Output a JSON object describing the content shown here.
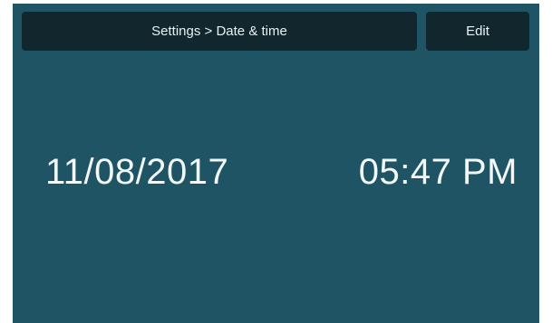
{
  "header": {
    "breadcrumb": "Settings > Date & time",
    "edit_label": "Edit"
  },
  "main": {
    "date": "11/08/2017",
    "time": "05:47 PM"
  },
  "colors": {
    "background": "#1f5464",
    "bar": "#12262e",
    "text": "#f2f7f8"
  }
}
